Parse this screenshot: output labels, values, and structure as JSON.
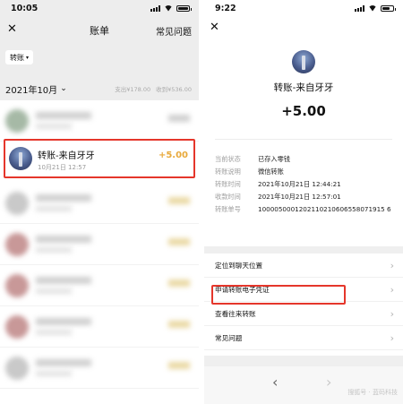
{
  "left": {
    "status": {
      "time": "10:05"
    },
    "nav": {
      "close": "✕",
      "title": "账单",
      "faq": "常见问题"
    },
    "filter_chip": {
      "label": "转账",
      "caret": "▾"
    },
    "month": {
      "label": "2021年10月",
      "caret": "⌄",
      "expense": "支出¥178.00",
      "income": "收到¥536.00"
    },
    "highlighted_row": {
      "name": "转账-来自牙牙",
      "date": "10月21日 12:57",
      "amount": "+5.00"
    }
  },
  "right": {
    "status": {
      "time": "9:22"
    },
    "nav": {
      "close": "✕"
    },
    "title": "转账-来自牙牙",
    "amount": "+5.00",
    "details": [
      {
        "key": "当前状态",
        "value": "已存入零钱"
      },
      {
        "key": "转账说明",
        "value": "微信转账"
      },
      {
        "key": "转账时间",
        "value": "2021年10月21日 12:44:21"
      },
      {
        "key": "收款时间",
        "value": "2021年10月21日 12:57:01"
      },
      {
        "key": "转账单号",
        "value": "1000050001202110210606558071915 6"
      }
    ],
    "menu": [
      {
        "label": "定位到聊天位置"
      },
      {
        "label": "申请转账电子凭证"
      },
      {
        "label": "查看往来转账"
      },
      {
        "label": "常见问题"
      }
    ],
    "chevron": "›",
    "bottom_nav": {
      "back": "‹",
      "forward": "›"
    },
    "watermark": "搜狐号 · 蓝码科技"
  },
  "colors": {
    "highlight": "#e5362b",
    "amount_gold": "#e8a93b"
  }
}
